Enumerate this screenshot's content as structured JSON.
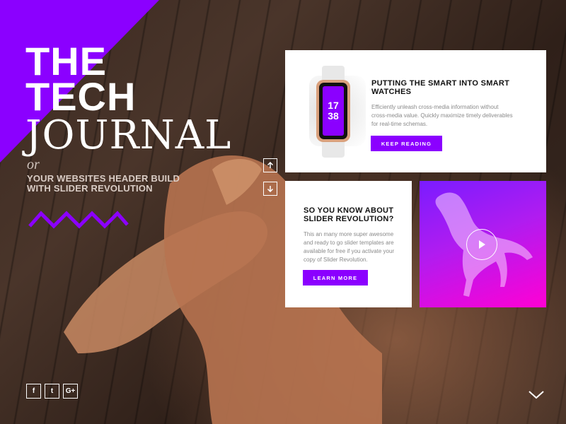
{
  "brand": {
    "line1": "THE",
    "line2": "TECH",
    "line3": "JOURNAL",
    "or": "or",
    "subtitle": "YOUR WEBSITES HEADER BUILD WITH SLIDER REVOLUTION"
  },
  "colors": {
    "accent": "#8b00ff",
    "card_bg": "#ffffff"
  },
  "nav": {
    "up_icon": "arrow-up-icon",
    "down_icon": "arrow-down-icon"
  },
  "card1": {
    "title": "PUTTING THE SMART INTO SMART WATCHES",
    "text": "Efficiently unleash cross-media information without cross-media value. Quickly maximize timely deliverables for real-time schemas.",
    "button": "KEEP READING",
    "watch_hour": "17",
    "watch_minute": "38"
  },
  "card2": {
    "title": "SO YOU KNOW ABOUT SLIDER REVOLUTION?",
    "text": "This an many more super awesome and ready to go slider templates are available for free if you activate your copy of Slider Revolution.",
    "button": "LEARN MORE"
  },
  "video": {
    "icon": "play-icon"
  },
  "social": [
    {
      "label": "f",
      "icon": "facebook-icon"
    },
    {
      "label": "t",
      "icon": "twitter-icon"
    },
    {
      "label": "G+",
      "icon": "google-plus-icon"
    }
  ]
}
